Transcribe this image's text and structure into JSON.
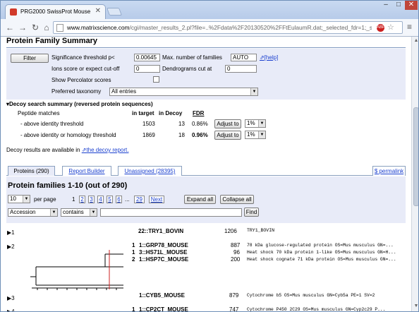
{
  "browser": {
    "tab_title": "PRG2000 SwissProt Mouse",
    "url_domain": "www.matrixscience.com",
    "url_path": "/cgi/master_results_2.pl?file=..%2Fdata%2F20130520%2FFtEulaumR.dat;_selected_fdr=1;_sigthre"
  },
  "summary": {
    "title": "Protein Family Summary",
    "filter_button": "Filter",
    "sig_label": "Significance threshold p<",
    "sig_value": "0.00645",
    "max_label": "Max. number of families",
    "max_value": "AUTO",
    "help_link": "[help]",
    "ions_label": "Ions score or expect cut-off",
    "ions_value": "0",
    "dendro_label": "Dendrograms cut at",
    "dendro_value": "0",
    "percolator_label": "Show Percolator scores",
    "taxonomy_label": "Preferred taxonomy",
    "taxonomy_value": "All entries"
  },
  "decoy": {
    "title": "Decoy search summary (reversed protein sequences)",
    "col_peptide": "Peptide matches",
    "col_target": "in target",
    "col_decoy": "in Decoy",
    "col_fdr": "FDR",
    "rows": [
      {
        "label": "- above identity threshold",
        "target": "1503",
        "decoy": "13",
        "fdr": "0.86%",
        "button": "Adjust to",
        "select": "1%"
      },
      {
        "label": "- above identity or homology threshold",
        "target": "1869",
        "decoy": "18",
        "fdr": "0.96%",
        "button": "Adjust to",
        "select": "1%"
      }
    ],
    "note_prefix": "Decoy results are available in",
    "note_link": "the decoy report."
  },
  "tabs": {
    "proteins": "Proteins (290)",
    "builder": "Report Builder",
    "unassigned": "Unassigned (28395)",
    "permalink": "permalink"
  },
  "families": {
    "title": "Protein families 1-10 (out of 290)",
    "per_page_value": "10",
    "per_page_label": "per page",
    "pages": [
      "1",
      "2",
      "3",
      "4",
      "5",
      "6",
      "...",
      "29",
      "Next"
    ],
    "expand": "Expand all",
    "collapse": "Collapse all",
    "search_field": "Accession",
    "search_op": "contains",
    "find": "Find"
  },
  "hits": [
    {
      "fam": "1",
      "members": [
        {
          "num": "2",
          "acc": "2::TRY1_BOVIN",
          "score": "1206",
          "desc": "TRY1_BOVIN"
        }
      ]
    },
    {
      "fam": "2",
      "members": [
        {
          "num": "1",
          "acc": "1::GRP78_MOUSE",
          "score": "887",
          "desc": "78 kDa glucose-regulated protein OS=Mus musculus GN=..."
        },
        {
          "num": "1",
          "acc": "3::HS71L_MOUSE",
          "score": "96",
          "desc": "Heat shock 70 kDa protein 1-like OS=Mus musculus GN=H..."
        },
        {
          "num": "2",
          "acc": "1::HSP7C_MOUSE",
          "score": "200",
          "desc": "Heat shock cognate 71 kDa protein OS=Mus musculus GN=..."
        }
      ]
    },
    {
      "fam": "3",
      "members": [
        {
          "num": "",
          "acc": "1::CYB5_MOUSE",
          "score": "879",
          "desc": "Cytochrome b5 OS=Mus musculus GN=Cyb5a PE=1 SV=2"
        }
      ]
    },
    {
      "fam": "4",
      "members": [
        {
          "num": "1",
          "acc": "1::CP2CT_MOUSE",
          "score": "747",
          "desc": "Cytochrome P450 2C29 OS=Mus musculus GN=Cyp2c29 P..."
        }
      ]
    }
  ]
}
